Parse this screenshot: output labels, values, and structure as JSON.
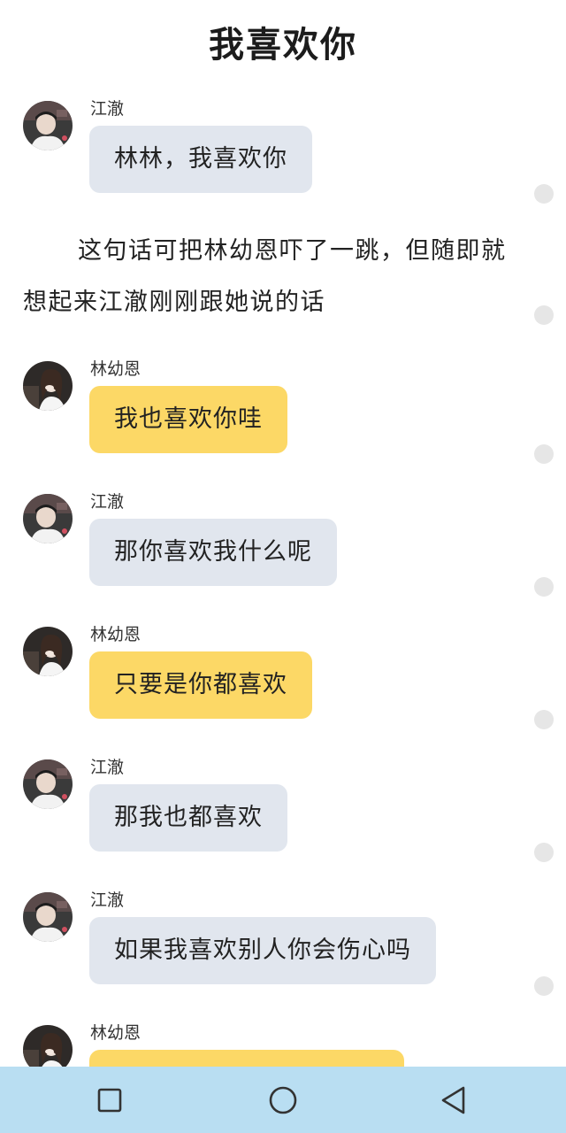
{
  "page_title": "我喜欢你",
  "narration": "这句话可把林幼恩吓了一跳，但随即就想起来江澈刚刚跟她说的话",
  "messages": [
    {
      "sender": "江澈",
      "text": "林林，我喜欢你",
      "bubble_color": "#e1e6ee",
      "avatar": "male-avatar"
    },
    {
      "sender": "林幼恩",
      "text": "我也喜欢你哇",
      "bubble_color": "#fcd866",
      "avatar": "female-avatar"
    },
    {
      "sender": "江澈",
      "text": "那你喜欢我什么呢",
      "bubble_color": "#e1e6ee",
      "avatar": "male-avatar"
    },
    {
      "sender": "林幼恩",
      "text": "只要是你都喜欢",
      "bubble_color": "#fcd866",
      "avatar": "female-avatar"
    },
    {
      "sender": "江澈",
      "text": "那我也都喜欢",
      "bubble_color": "#e1e6ee",
      "avatar": "male-avatar"
    },
    {
      "sender": "江澈",
      "text": "如果我喜欢别人你会伤心吗",
      "bubble_color": "#e1e6ee",
      "avatar": "male-avatar"
    },
    {
      "sender": "林幼恩",
      "text": "",
      "bubble_color": "#fcd866",
      "avatar": "female-avatar"
    }
  ],
  "navbar": {
    "background": "#b9def2",
    "buttons": [
      "square-recents-icon",
      "circle-home-icon",
      "triangle-back-icon"
    ]
  }
}
